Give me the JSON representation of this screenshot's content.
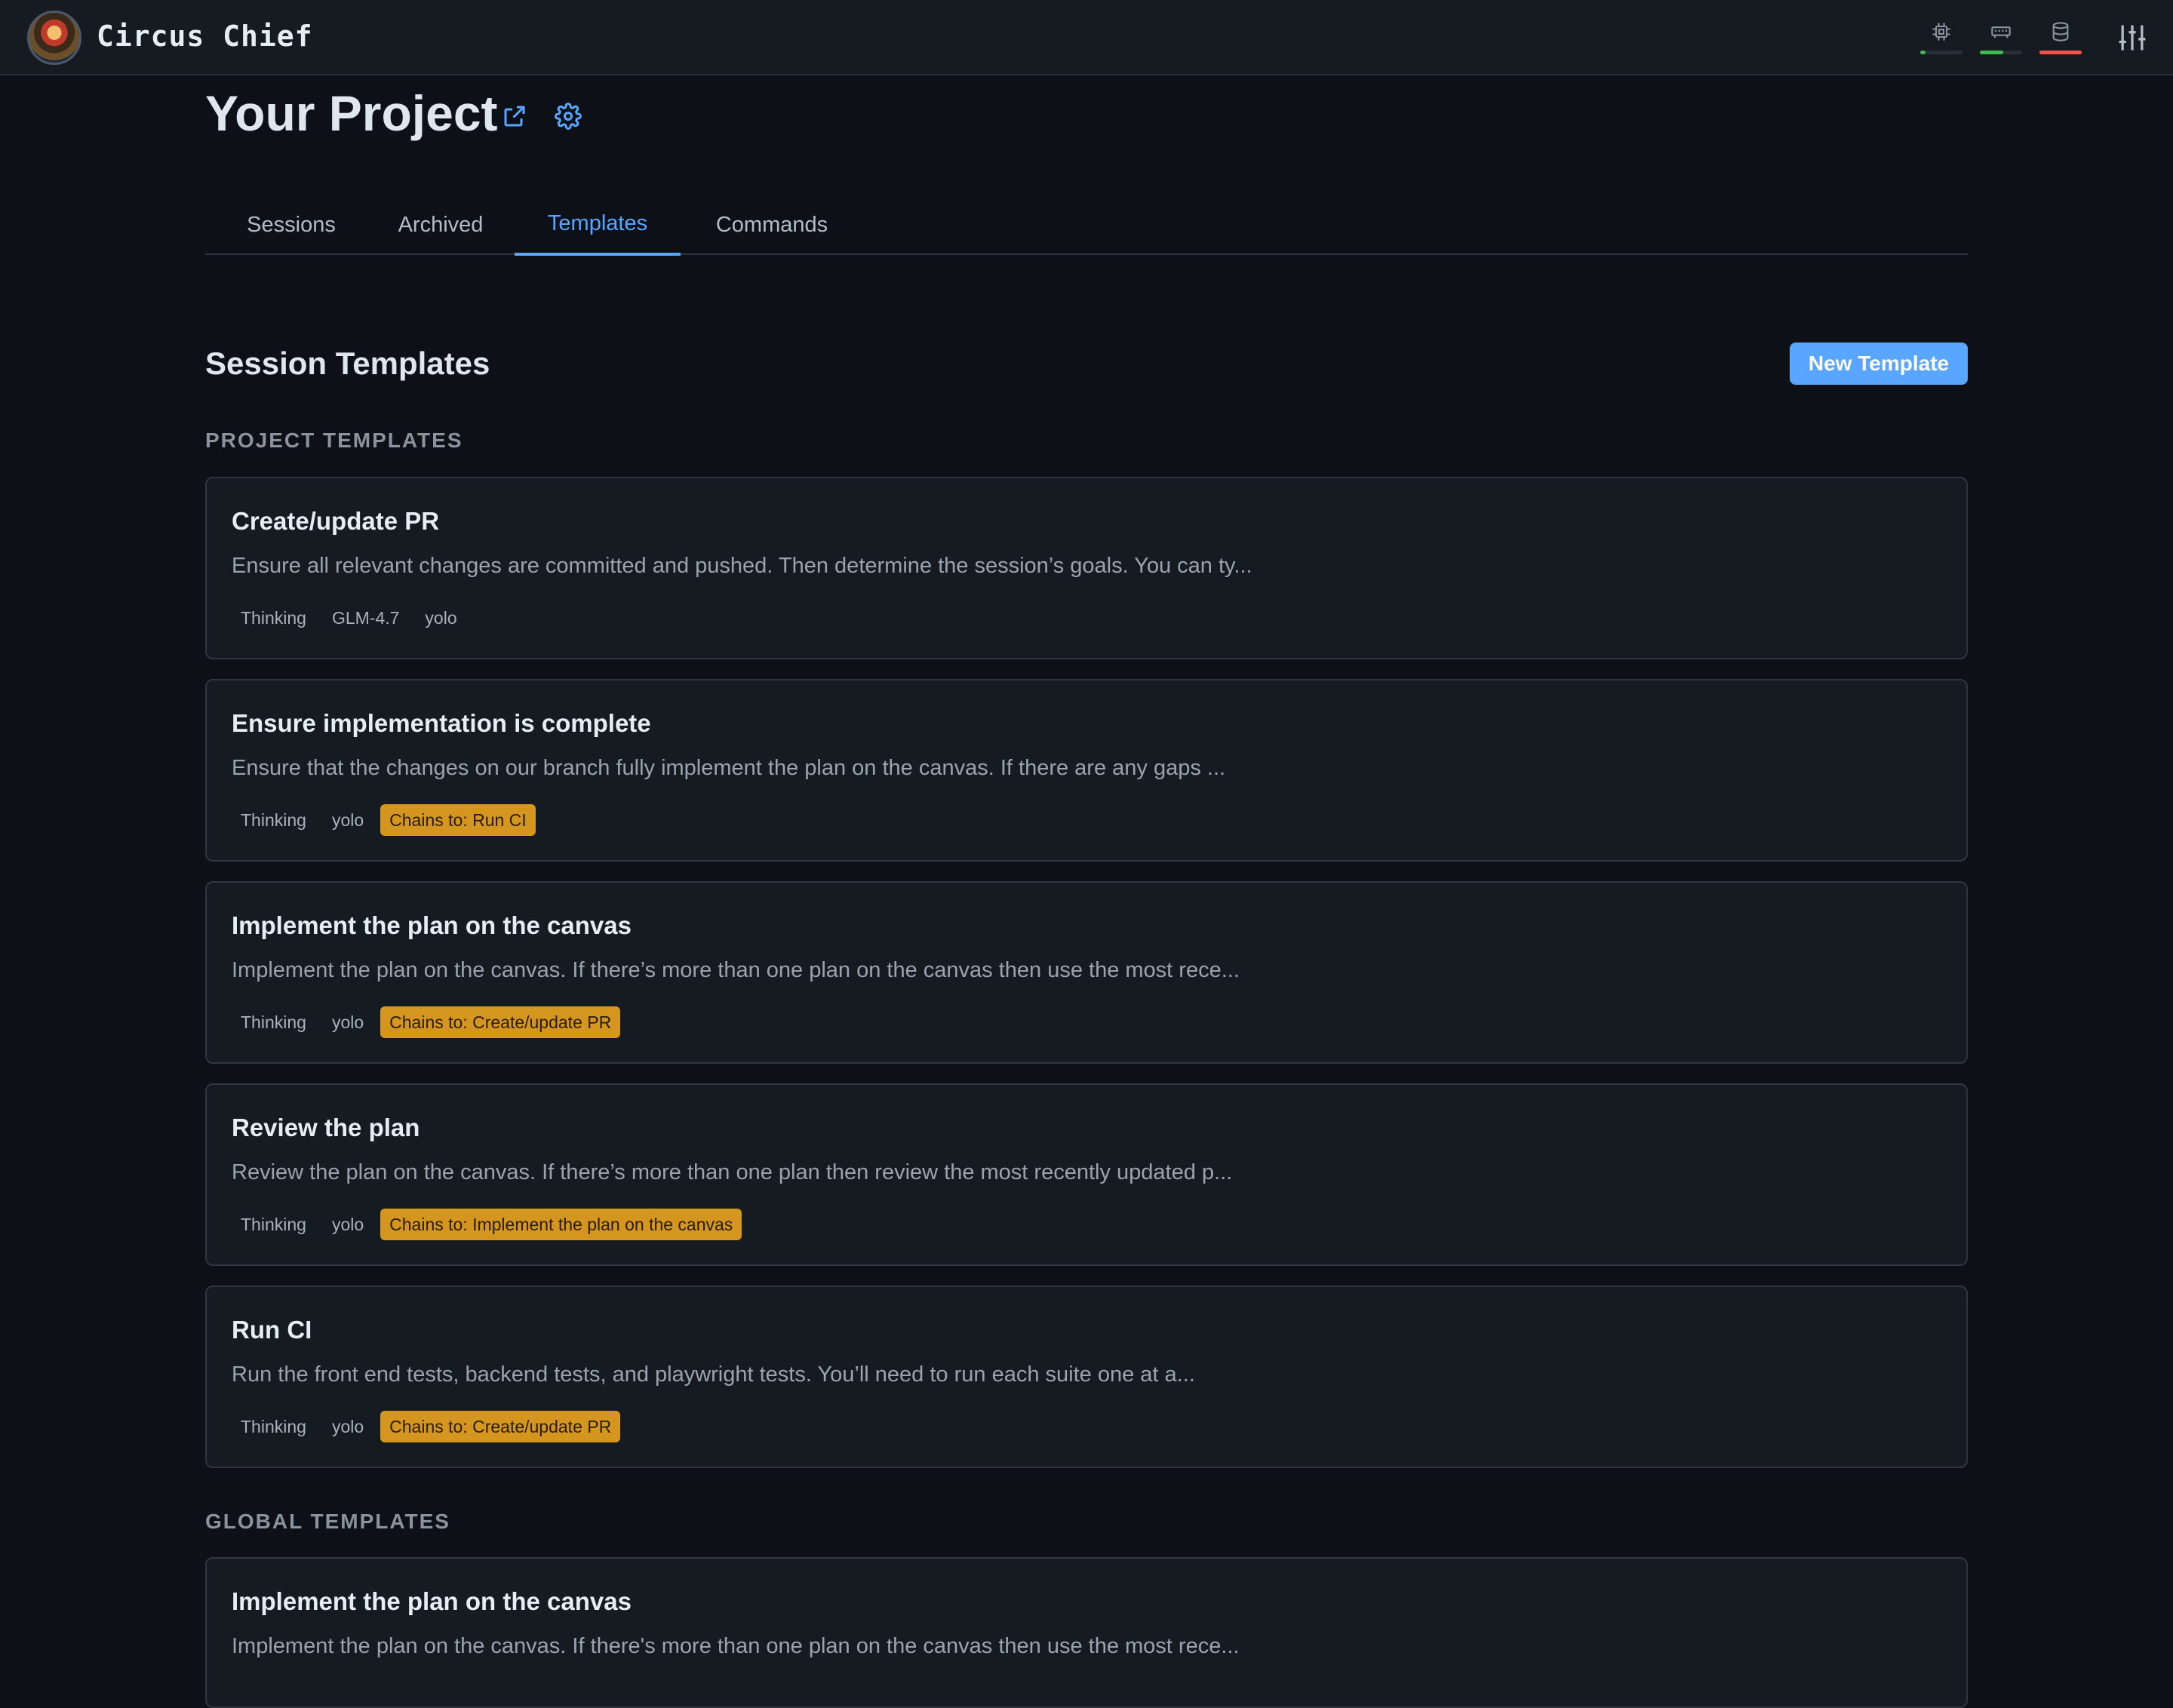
{
  "app": {
    "title": "Circus Chief"
  },
  "header": {
    "indicators": [
      {
        "icon": "cpu-icon",
        "level": 0.12,
        "color": "#3fb950"
      },
      {
        "icon": "memory-icon",
        "level": 0.55,
        "color": "#3fb950"
      },
      {
        "icon": "database-icon",
        "level": 1.0,
        "color": "#f85149"
      }
    ]
  },
  "project": {
    "title": "Your Project"
  },
  "tabs": [
    {
      "label": "Sessions"
    },
    {
      "label": "Archived"
    },
    {
      "label": "Templates",
      "active": true
    },
    {
      "label": "Commands"
    }
  ],
  "main": {
    "section_title": "Session Templates",
    "new_template_label": "New Template",
    "project_templates_label": "PROJECT TEMPLATES",
    "global_templates_label": "GLOBAL TEMPLATES"
  },
  "project_templates": [
    {
      "title": "Create/update PR",
      "description": "Ensure all relevant changes are committed and pushed. Then determine the session’s goals. You can ty...",
      "badges": [
        "Thinking",
        "GLM-4.7",
        "yolo"
      ]
    },
    {
      "title": "Ensure implementation is complete",
      "description": "Ensure that the changes on our branch fully implement the plan on the canvas. If there are any gaps ...",
      "badges": [
        "Thinking",
        "yolo"
      ],
      "chain": "Chains to: Run CI"
    },
    {
      "title": "Implement the plan on the canvas",
      "description": "Implement the plan on the canvas. If there’s more than one plan on the canvas then use the most rece...",
      "badges": [
        "Thinking",
        "yolo"
      ],
      "chain": "Chains to: Create/update PR"
    },
    {
      "title": "Review the plan",
      "description": "Review the plan on the canvas. If there’s more than one plan then review the most recently updated p...",
      "badges": [
        "Thinking",
        "yolo"
      ],
      "chain": "Chains to: Implement the plan on the canvas"
    },
    {
      "title": "Run CI",
      "description": "Run the front end tests, backend tests, and playwright tests. You’ll need to run each suite one at a...",
      "badges": [
        "Thinking",
        "yolo"
      ],
      "chain": "Chains to: Create/update PR"
    }
  ],
  "global_templates": [
    {
      "title": "Implement the plan on the canvas",
      "description": "Implement the plan on the canvas. If there's more than one plan on the canvas then use the most rece..."
    }
  ]
}
